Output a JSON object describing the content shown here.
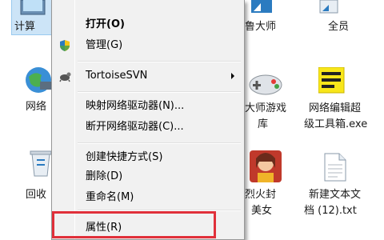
{
  "desktop": {
    "icons_left": [
      {
        "label": "计算"
      },
      {
        "label": "网络"
      },
      {
        "label": "回收"
      }
    ],
    "icons_mid": [
      {
        "label": "鲁大师"
      },
      {
        "label": "大师游戏"
      },
      {
        "label2": "库"
      },
      {
        "label": "烈火封"
      },
      {
        "label2": "美女"
      }
    ],
    "icons_right": [
      {
        "label": "全员"
      },
      {
        "label": "网络编辑超"
      },
      {
        "label2": "级工具箱.exe"
      },
      {
        "label": "新建文本文"
      },
      {
        "label2": "档 (12).txt"
      }
    ]
  },
  "menu": {
    "items": [
      {
        "label": "打开(O)"
      },
      {
        "label": "管理(G)"
      },
      {
        "label": "TortoiseSVN"
      },
      {
        "label": "映射网络驱动器(N)..."
      },
      {
        "label": "断开网络驱动器(C)..."
      },
      {
        "label": "创建快捷方式(S)"
      },
      {
        "label": "删除(D)"
      },
      {
        "label": "重命名(M)"
      },
      {
        "label": "属性(R)"
      }
    ]
  },
  "colors": {
    "highlight": "#e0303a",
    "menu_bg": "#f1f1f1",
    "selection": "#cce4f7"
  }
}
